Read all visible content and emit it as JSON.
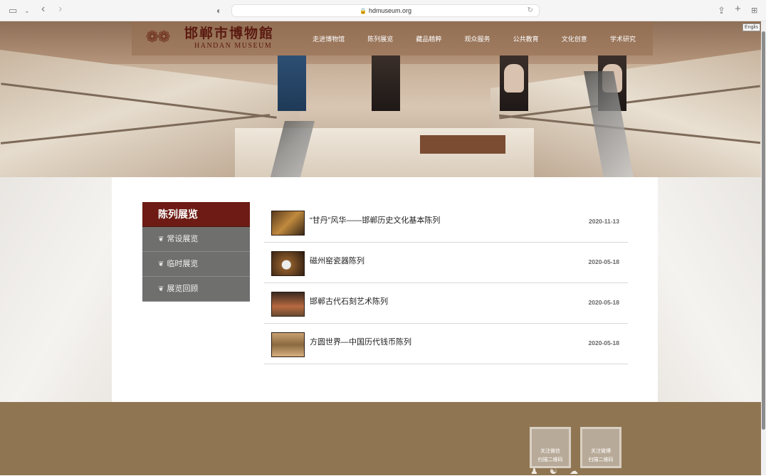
{
  "browser": {
    "url": "hdmuseum.org",
    "icons": [
      "sidebar-icon",
      "chevron-down-icon",
      "back-icon",
      "forward-icon",
      "privacy-shield-icon",
      "lock-icon",
      "reload-icon",
      "share-icon",
      "new-tab-icon",
      "tab-overview-icon"
    ]
  },
  "site": {
    "logo_cn": "邯郸市博物館",
    "logo_en": "HANDAN MUSEUM",
    "english_label": "Englis",
    "nav": [
      "走进博物馆",
      "陈列展览",
      "藏品精粹",
      "观众服务",
      "公共教育",
      "文化创意",
      "学术研究"
    ]
  },
  "sidebar": {
    "title": "陈列展览",
    "items": [
      {
        "label": "常设展览"
      },
      {
        "label": "临时展览"
      },
      {
        "label": "展览回顾"
      }
    ]
  },
  "exhibitions": [
    {
      "title": "“甘丹”风华——邯郸历史文化基本陈列",
      "date": "2020-11-13"
    },
    {
      "title": "磁州窑瓷器陈列",
      "date": "2020-05-18"
    },
    {
      "title": "邯郸古代石刻艺术陈列",
      "date": "2020-05-18"
    },
    {
      "title": "方圆世界—中国历代钱币陈列",
      "date": "2020-05-18"
    }
  ],
  "footer": {
    "qr1": {
      "line1": "关注微信",
      "line2": "扫描二维码"
    },
    "qr2": {
      "line1": "关注微博",
      "line2": "扫描二维码"
    }
  }
}
